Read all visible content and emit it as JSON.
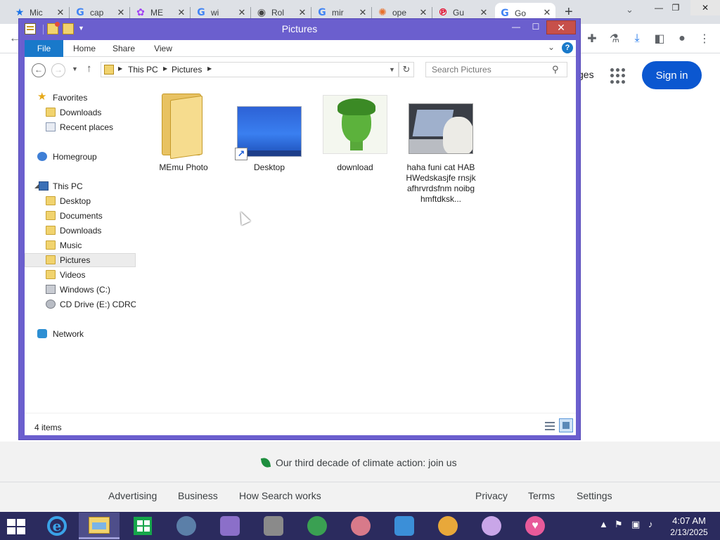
{
  "browser": {
    "tabs": [
      {
        "label": "Mic",
        "icon": "star-icon",
        "color": "#1a73e8"
      },
      {
        "label": "cap",
        "icon": "google-g-icon",
        "color": "#4285f4"
      },
      {
        "label": "ME",
        "icon": "memu-icon",
        "color": "#a142f4"
      },
      {
        "label": "wi",
        "icon": "google-g-icon",
        "color": "#4285f4"
      },
      {
        "label": "Rol",
        "icon": "roblox-icon",
        "color": "#444444"
      },
      {
        "label": "mir",
        "icon": "google-g-icon",
        "color": "#4285f4"
      },
      {
        "label": "ope",
        "icon": "openai-icon",
        "color": "#e8702a"
      },
      {
        "label": "Gu",
        "icon": "pinterest-icon",
        "color": "#e60023"
      },
      {
        "label": "Go",
        "icon": "google-g-icon",
        "color": "#4285f4",
        "active": true
      }
    ],
    "new_tab": "+",
    "google": {
      "images_link": "ges",
      "signin_label": "Sign in",
      "climate_text": "Our third decade of climate action: join us",
      "footer_left": [
        "Advertising",
        "Business",
        "How Search works"
      ],
      "footer_right": [
        "Privacy",
        "Terms",
        "Settings"
      ]
    }
  },
  "explorer": {
    "title": "Pictures",
    "ribbon_tabs": [
      "File",
      "Home",
      "Share",
      "View"
    ],
    "breadcrumb": [
      "This PC",
      "Pictures"
    ],
    "search_placeholder": "Search Pictures",
    "nav": {
      "favorites_header": "Favorites",
      "favorites": [
        "Downloads",
        "Recent places"
      ],
      "homegroup": "Homegroup",
      "thispc_header": "This PC",
      "thispc": [
        "Desktop",
        "Documents",
        "Downloads",
        "Music",
        "Pictures",
        "Videos",
        "Windows (C:)",
        "CD Drive (E:) CDROM"
      ],
      "selected": "Pictures",
      "network": "Network"
    },
    "files": [
      {
        "name": "MEmu Photo",
        "kind": "folder"
      },
      {
        "name": "Desktop",
        "kind": "shortcut"
      },
      {
        "name": "download",
        "kind": "image"
      },
      {
        "name": "haha funi cat HABHWedskasjfe rnsjkafhrvrdsfnm noibghmftdksk...",
        "kind": "image"
      }
    ],
    "status": "4 items"
  },
  "taskbar": {
    "apps": [
      "ie-icon",
      "file-explorer-icon",
      "store-icon",
      "media-icon",
      "paint-icon",
      "tiles-icon",
      "idm-icon",
      "brain-icon",
      "photos-icon",
      "ball-icon",
      "palette-icon",
      "heart-icon"
    ],
    "active_app": "file-explorer-icon",
    "time": "4:07 AM",
    "date": "2/13/2025"
  }
}
